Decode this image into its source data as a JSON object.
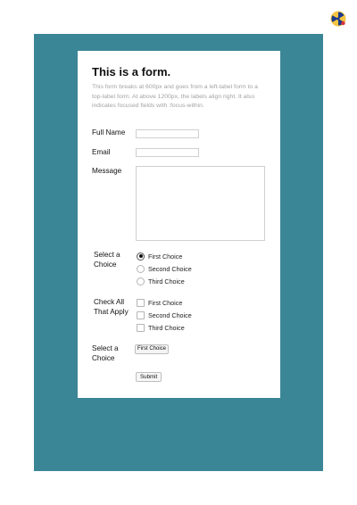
{
  "form": {
    "title": "This is a form.",
    "description": "This form breaks at 600px and goes from a left-label form to a top-label form. At above 1200px, the labels align right. It also indicates focused fields with :focus-within.",
    "full_name_label": "Full Name",
    "full_name_value": "",
    "email_label": "Email",
    "email_value": "",
    "message_label": "Message",
    "message_value": "",
    "radio_group_label": "Select a Choice",
    "radio_options": [
      "First Choice",
      "Second Choice",
      "Third Choice"
    ],
    "radio_selected": "First Choice",
    "checkbox_group_label": "Check All That Apply",
    "checkbox_options": [
      "First Choice",
      "Second Choice",
      "Third Choice"
    ],
    "select_label": "Select a Choice",
    "select_value": "First Choice",
    "submit_label": "Submit"
  },
  "colors": {
    "panel": "#3b8696",
    "card": "#ffffff",
    "description_text": "#a3a3a3"
  },
  "icons": {
    "top_right": "radiation-logo-icon"
  }
}
